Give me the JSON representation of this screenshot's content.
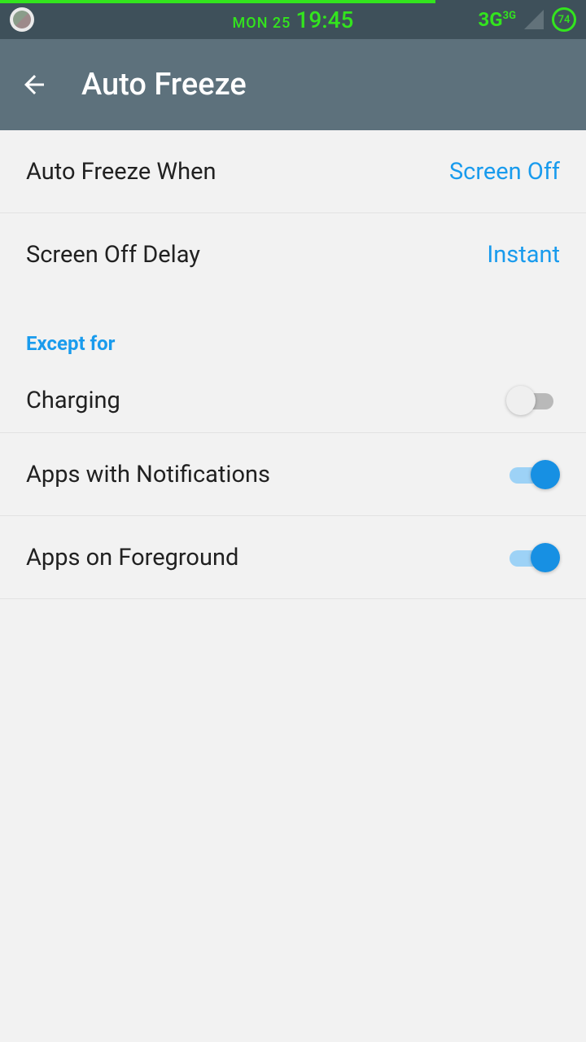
{
  "status": {
    "date": "MON 25",
    "time": "19:45",
    "network": "3G",
    "network_sup": "3G",
    "battery": "74"
  },
  "header": {
    "title": "Auto Freeze"
  },
  "settings": {
    "auto_freeze_when": {
      "label": "Auto Freeze When",
      "value": "Screen Off"
    },
    "screen_off_delay": {
      "label": "Screen Off Delay",
      "value": "Instant"
    }
  },
  "section": {
    "except_for": "Except for"
  },
  "toggles": {
    "charging": {
      "label": "Charging",
      "on": false
    },
    "apps_notifications": {
      "label": "Apps with Notifications",
      "on": true
    },
    "apps_foreground": {
      "label": "Apps on Foreground",
      "on": true
    }
  }
}
